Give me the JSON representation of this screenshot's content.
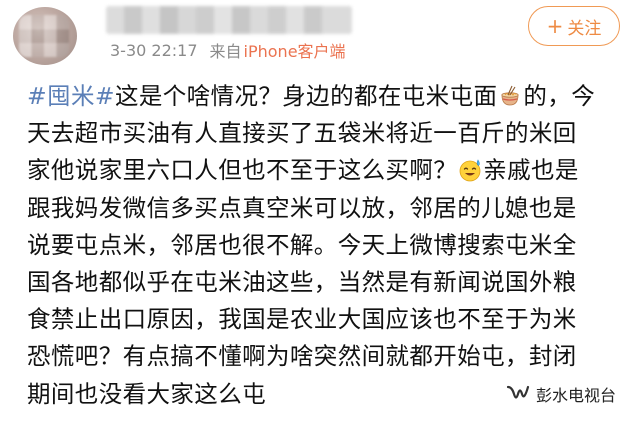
{
  "post": {
    "meta": {
      "time": "3-30 22:17",
      "source_prefix": "来自",
      "source_link": "iPhone客户端"
    },
    "follow_button": {
      "plus": "+",
      "label": "关注"
    },
    "content": {
      "lines": [
        [
          "#囤米#",
          "这是个啥情况？身边的都在屯米屯面",
          "的，今"
        ],
        [
          "天去超市买油有人直接买了五袋米将近一百斤的米回"
        ],
        [
          "家他说家里六口人但也不至于这么买啊？",
          "亲戚也是"
        ],
        [
          "跟我妈发微信多买点真空米可以放，邻居的儿媳也是"
        ],
        [
          "说要屯点米，邻居也很不解。今天上微博搜索屯米全"
        ],
        [
          "国各地都似乎在屯米油这些，当然是有新闻说国外粮"
        ],
        [
          "食禁止出口原因，我国是农业大国应该也不至于为米"
        ],
        [
          "恐慌吧？有点搞不懂啊为啥突然间就都开始屯，封闭"
        ],
        [
          "期间也没看大家这么屯"
        ]
      ],
      "emojis": [
        "noodle-bowl-icon",
        "sweat-smile-icon"
      ]
    },
    "watermark": {
      "icon": "wechat-channel-icon",
      "label": "彭水电视台"
    },
    "colors": {
      "hashtag": "#5b7fb7",
      "source_link": "#eb7350",
      "follow_accent": "#ee8b44",
      "meta_gray": "#8a8a8a"
    }
  }
}
